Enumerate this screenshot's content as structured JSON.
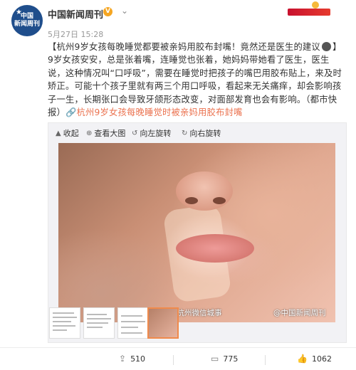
{
  "account": {
    "avatar_text_1": "中国",
    "avatar_text_2": "新闻周刊",
    "name": "中国新闻周刊",
    "verified_badge": "V",
    "time": "5月27日 15:28"
  },
  "post": {
    "line1": "【杭州9岁女孩每晚睡觉都要被亲妈用胶布封嘴！竟然还是医生的建议",
    "line1_end": "】9岁女",
    "body": "孩安安，总是张着嘴，连睡觉也张着，她妈妈带她看了医生，医生说，这种情况叫“口呼吸”，需要在睡觉时把孩子的嘴巴用胶布贴上，来及时矫正。可能十个孩子里就有两三个用口呼吸，看起来无关痛痒，却会影响孩子一生，长期张口会导致牙颌形态改变，对面部发育也会有影响。（都市快报）",
    "link_text": "杭州9岁女孩每晚睡觉时被亲妈用胶布封嘴",
    "link_color": "#eb7350"
  },
  "media_tools": {
    "collapse": "收起",
    "view_large": "查看大图",
    "rotate_left": "向左旋转",
    "rotate_right": "向右旋转"
  },
  "photo": {
    "watermark_left": "@杭州微信城事",
    "watermark_right": "@中国新闻周刊"
  },
  "actions": {
    "repost_count": "510",
    "comment_count": "775",
    "like_count": "1062"
  }
}
